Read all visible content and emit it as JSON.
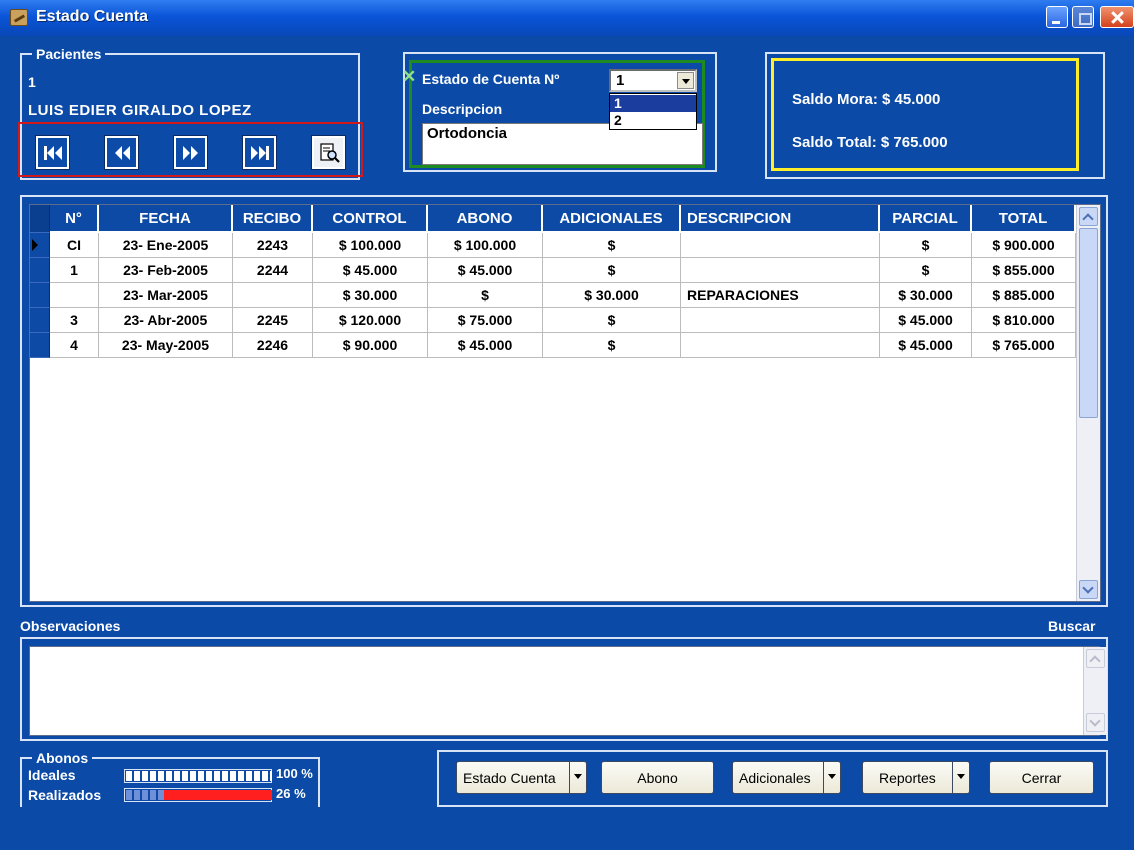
{
  "window": {
    "title": "Estado Cuenta"
  },
  "pacientes": {
    "legend": "Pacientes",
    "id": "1",
    "name": "LUIS EDIER GIRALDO LOPEZ"
  },
  "estado": {
    "label": "Estado de Cuenta Nº",
    "selected": "1",
    "options": [
      "1",
      "2"
    ],
    "descripcion_label": "Descripcion",
    "descripcion_value": "Ortodoncia"
  },
  "saldo": {
    "mora": "Saldo Mora: $ 45.000",
    "total": "Saldo Total: $ 765.000"
  },
  "table": {
    "columns": [
      "N°",
      "FECHA",
      "RECIBO",
      "CONTROL",
      "ABONO",
      "ADICIONALES",
      "DESCRIPCION",
      "PARCIAL",
      "TOTAL"
    ],
    "rows": [
      [
        "CI",
        "23- Ene-2005",
        "2243",
        "$ 100.000",
        "$ 100.000",
        "$",
        "",
        "$",
        "$ 900.000"
      ],
      [
        "1",
        "23- Feb-2005",
        "2244",
        "$ 45.000",
        "$ 45.000",
        "$",
        "",
        "$",
        "$ 855.000"
      ],
      [
        "",
        "23- Mar-2005",
        "",
        "$ 30.000",
        "$",
        "$ 30.000",
        "REPARACIONES",
        "$ 30.000",
        "$ 885.000"
      ],
      [
        "3",
        "23- Abr-2005",
        "2245",
        "$ 120.000",
        "$ 75.000",
        "$",
        "",
        "$ 45.000",
        "$ 810.000"
      ],
      [
        "4",
        "23- May-2005",
        "2246",
        "$ 90.000",
        "$ 45.000",
        "$",
        "",
        "$ 45.000",
        "$ 765.000"
      ]
    ]
  },
  "observaciones": {
    "label": "Observaciones",
    "buscar": "Buscar",
    "value": ""
  },
  "abonos": {
    "legend": "Abonos",
    "ideales_label": "Ideales",
    "ideales_pct": "100 %",
    "ideales_fraction": 1.0,
    "realizados_label": "Realizados",
    "realizados_pct": "26 %",
    "realizados_fraction": 0.26
  },
  "buttons": {
    "estado_cuenta": "Estado Cuenta",
    "abono": "Abono",
    "adicionales": "Adicionales",
    "reportes": "Reportes",
    "cerrar": "Cerrar"
  },
  "colors": {
    "window_bg": "#0b4aa6",
    "nav_highlight": "#d21818",
    "estado_highlight": "#1d8a22",
    "saldo_highlight": "#ffee2a",
    "realizados_bar": "#ff1f1f"
  }
}
